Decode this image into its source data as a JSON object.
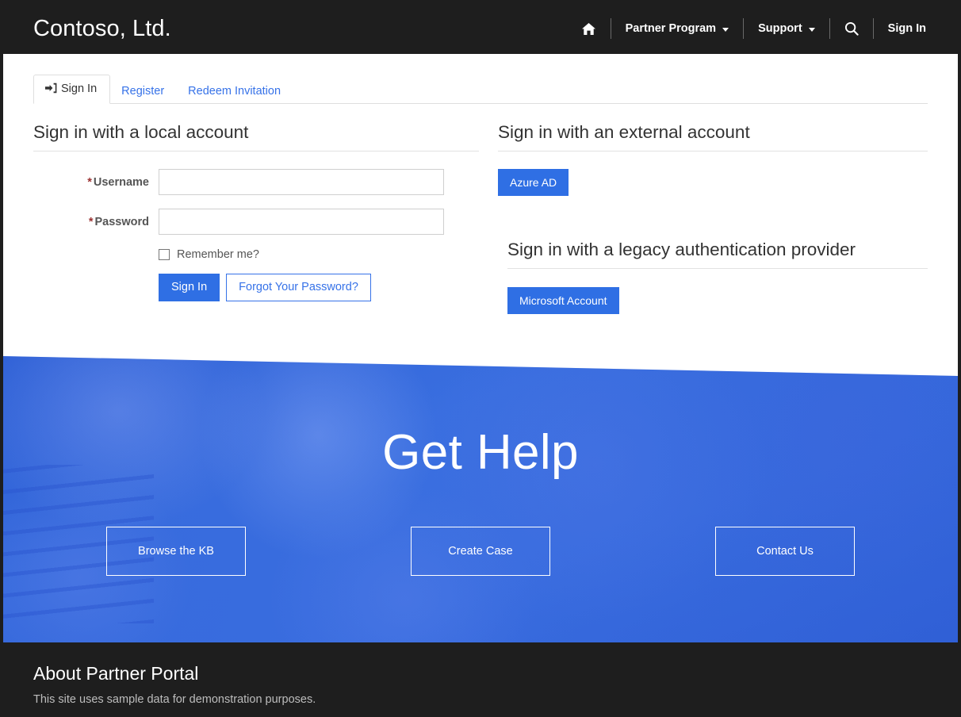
{
  "brand": {
    "name": "Contoso, Ltd."
  },
  "nav": {
    "home_icon": "home-icon",
    "items": [
      {
        "label": "Partner Program",
        "has_caret": true
      },
      {
        "label": "Support",
        "has_caret": true
      }
    ],
    "search_icon": "search-icon",
    "signin_label": "Sign In"
  },
  "tabs": [
    {
      "label": "Sign In",
      "icon": "sign-in-icon",
      "active": true
    },
    {
      "label": "Register",
      "active": false
    },
    {
      "label": "Redeem Invitation",
      "active": false
    }
  ],
  "local": {
    "heading": "Sign in with a local account",
    "username_label": "Username",
    "username_value": "",
    "username_placeholder": "",
    "password_label": "Password",
    "password_value": "",
    "password_placeholder": "",
    "required_marker": "*",
    "remember_label": "Remember me?",
    "remember_checked": false,
    "signin_button": "Sign In",
    "forgot_button": "Forgot Your Password?"
  },
  "external": {
    "heading": "Sign in with an external account",
    "providers": [
      {
        "label": "Azure AD"
      }
    ]
  },
  "legacy": {
    "heading": "Sign in with a legacy authentication provider",
    "providers": [
      {
        "label": "Microsoft Account"
      }
    ]
  },
  "hero": {
    "title": "Get Help",
    "buttons": [
      {
        "label": "Browse the KB"
      },
      {
        "label": "Create Case"
      },
      {
        "label": "Contact Us"
      }
    ]
  },
  "footer": {
    "heading": "About Partner Portal",
    "text": "This site uses sample data for demonstration purposes."
  },
  "colors": {
    "nav_background": "#1e1e1e",
    "accent_blue": "#2f6fe4",
    "link_blue": "#3672e8",
    "required_red": "#9b3232",
    "hero_blue": "#3a6fe0"
  }
}
